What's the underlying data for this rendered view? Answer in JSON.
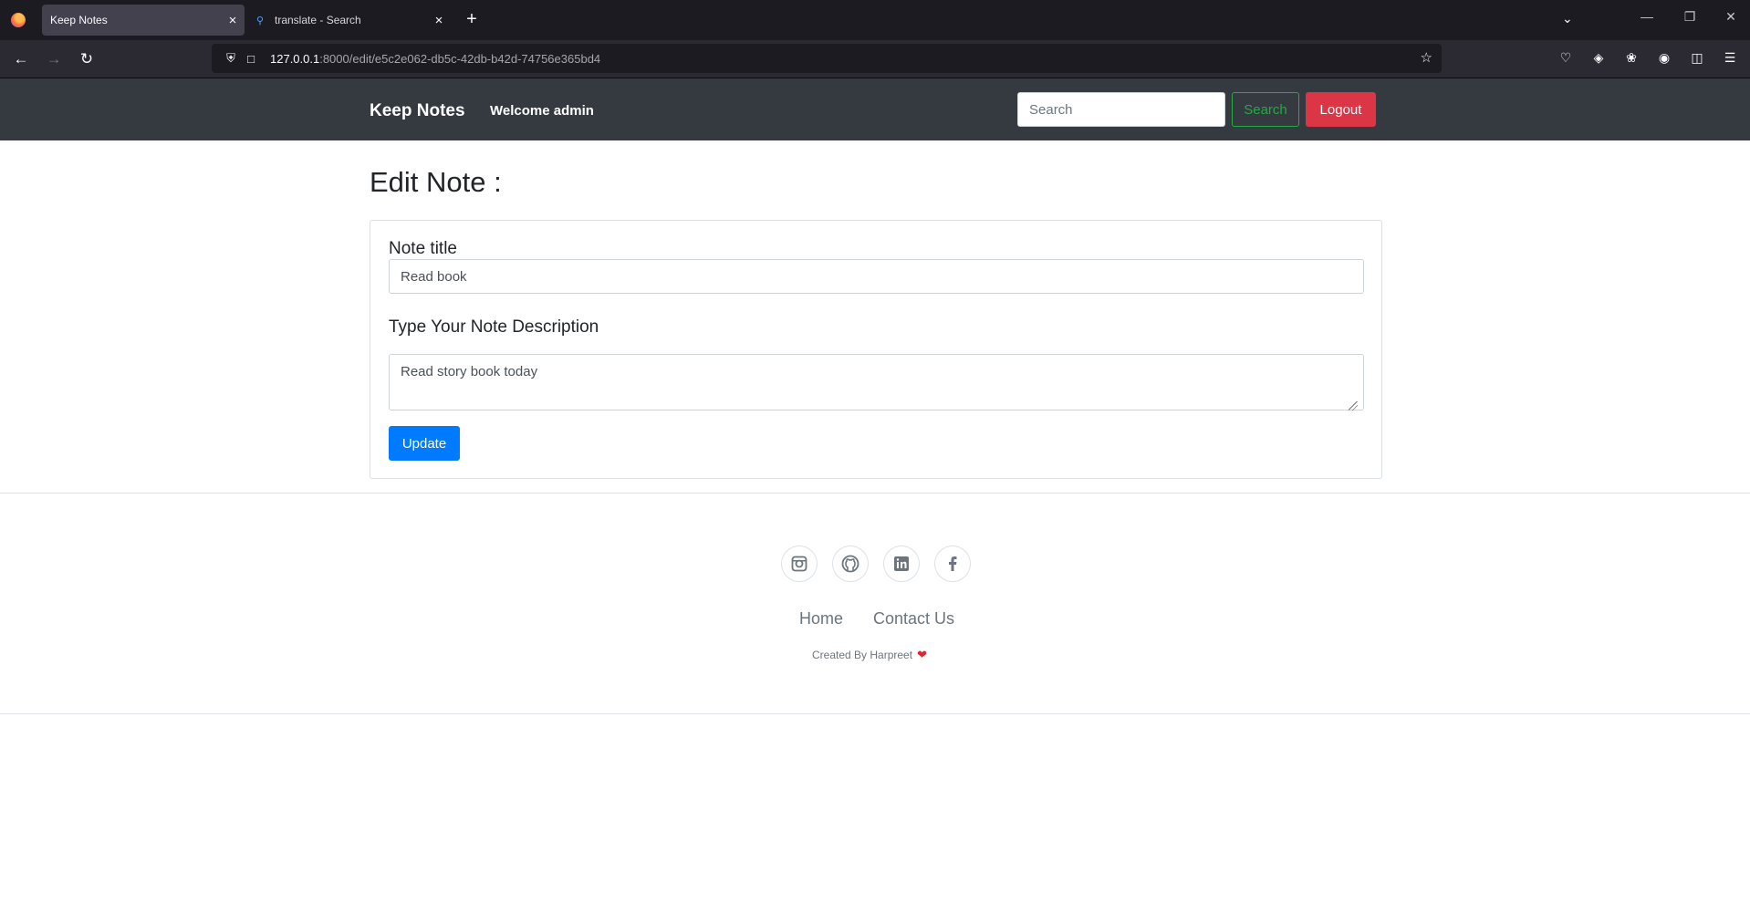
{
  "browser": {
    "tabs": [
      {
        "title": "Keep Notes",
        "active": true
      },
      {
        "title": "translate - Search",
        "active": false
      }
    ],
    "url_host": "127.0.0.1",
    "url_path": ":8000/edit/e5c2e062-db5c-42db-b42d-74756e365bd4"
  },
  "site_nav": {
    "brand": "Keep Notes",
    "welcome": "Welcome admin",
    "search_placeholder": "Search",
    "search_button": "Search",
    "logout_button": "Logout"
  },
  "page": {
    "title": "Edit Note :",
    "form": {
      "title_label": "Note title",
      "title_value": "Read book",
      "desc_label": "Type Your Note Description",
      "desc_value": "Read story book today",
      "submit_label": "Update"
    }
  },
  "footer": {
    "social_icons": [
      "instagram-icon",
      "github-icon",
      "linkedin-icon",
      "facebook-icon"
    ],
    "links": [
      "Home",
      "Contact Us"
    ],
    "credit": "Created By Harpreet"
  },
  "colors": {
    "navbar": "#343a40",
    "primary": "#007bff",
    "success": "#28a745",
    "danger": "#dc3545"
  }
}
